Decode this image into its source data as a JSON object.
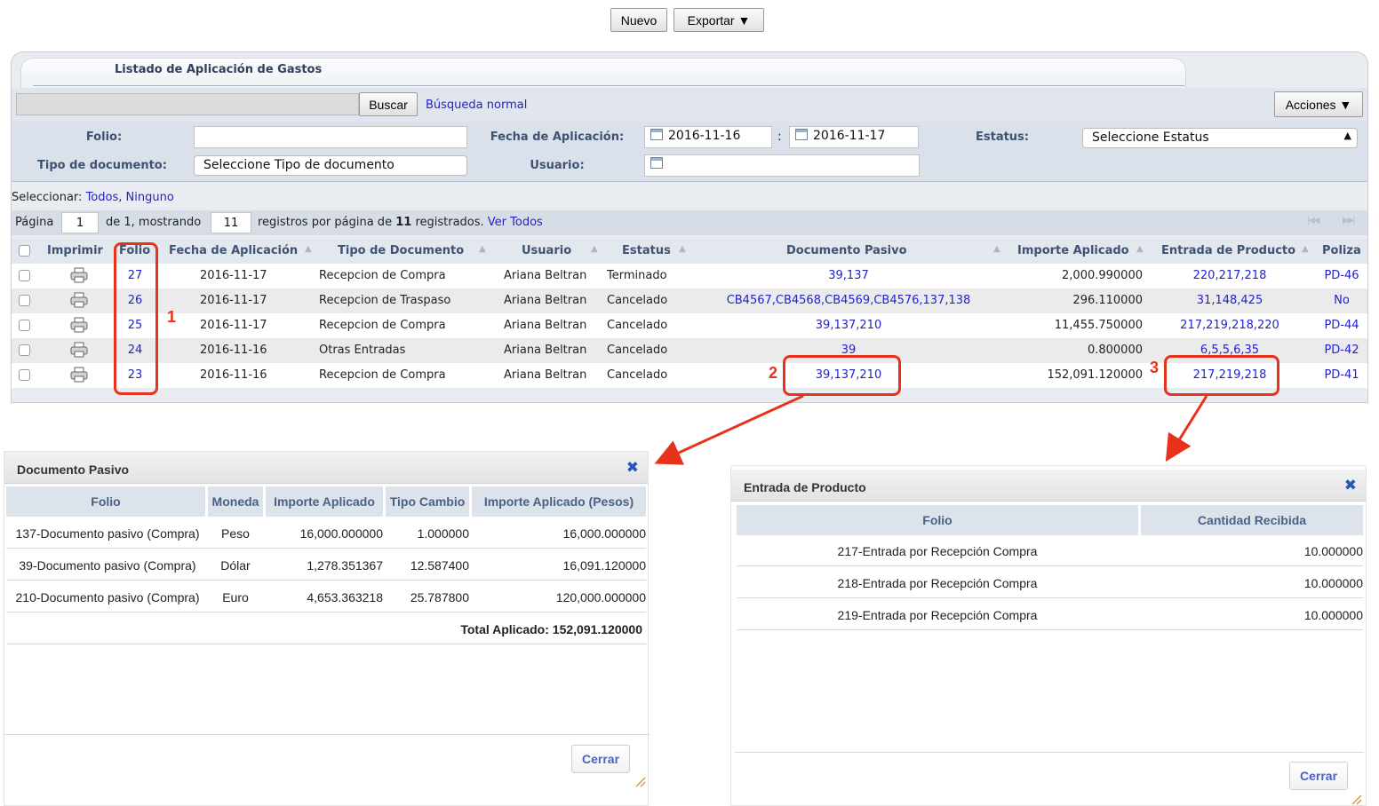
{
  "top_buttons": {
    "nuevo": "Nuevo",
    "exportar": "Exportar ▼"
  },
  "panel": {
    "title": "Listado de Aplicación de Gastos"
  },
  "search": {
    "button": "Buscar",
    "mode_link": "Búsqueda normal",
    "acciones": "Acciones ▼"
  },
  "filters": {
    "folio_label": "Folio:",
    "fecha_label": "Fecha de Aplicación:",
    "fecha_desde": "2016-11-16",
    "sep": ":",
    "fecha_hasta": "2016-11-17",
    "estatus_label": "Estatus:",
    "estatus_value": "Seleccione Estatus",
    "tipo_label": "Tipo de documento:",
    "tipo_value": "Seleccione Tipo de documento",
    "usuario_label": "Usuario:"
  },
  "selection": {
    "label": "Seleccionar:",
    "all": "Todos",
    "comma": ",",
    "none": "Ninguno"
  },
  "pager": {
    "pagina_label": "Página",
    "page": "1",
    "of_text": "de 1, mostrando",
    "per_page": "11",
    "registros_text": "registros por página de",
    "total": "11",
    "registrados": "registrados.",
    "ver_todos": "Ver Todos",
    "nav_first": "|◀◀",
    "nav_last": "▶▶|"
  },
  "columns": {
    "imprimir": "Imprimir",
    "folio": "Folio",
    "fecha": "Fecha de Aplicación",
    "tipo": "Tipo de Documento",
    "usuario": "Usuario",
    "estatus": "Estatus",
    "doc_pasivo": "Documento Pasivo",
    "importe": "Importe Aplicado",
    "entrada": "Entrada de Producto",
    "poliza": "Poliza"
  },
  "rows": [
    {
      "folio": "27",
      "fecha": "2016-11-17",
      "tipo": "Recepcion de Compra",
      "usuario": "Ariana Beltran",
      "estatus": "Terminado",
      "doc_pasivo": "39,137",
      "importe": "2,000.990000",
      "entrada": "220,217,218",
      "poliza": "PD-46"
    },
    {
      "folio": "26",
      "fecha": "2016-11-17",
      "tipo": "Recepcion de Traspaso",
      "usuario": "Ariana Beltran",
      "estatus": "Cancelado",
      "doc_pasivo": "CB4567,CB4568,CB4569,CB4576,137,138",
      "importe": "296.110000",
      "entrada": "31,148,425",
      "poliza": "No"
    },
    {
      "folio": "25",
      "fecha": "2016-11-17",
      "tipo": "Recepcion de Compra",
      "usuario": "Ariana Beltran",
      "estatus": "Cancelado",
      "doc_pasivo": "39,137,210",
      "importe": "11,455.750000",
      "entrada": "217,219,218,220",
      "poliza": "PD-44"
    },
    {
      "folio": "24",
      "fecha": "2016-11-16",
      "tipo": "Otras Entradas",
      "usuario": "Ariana Beltran",
      "estatus": "Cancelado",
      "doc_pasivo": "39",
      "importe": "0.800000",
      "entrada": "6,5,5,6,35",
      "poliza": "PD-42"
    },
    {
      "folio": "23",
      "fecha": "2016-11-16",
      "tipo": "Recepcion de Compra",
      "usuario": "Ariana Beltran",
      "estatus": "Cancelado",
      "doc_pasivo": "39,137,210",
      "importe": "152,091.120000",
      "entrada": "217,219,218",
      "poliza": "PD-41"
    }
  ],
  "annotations": {
    "one": "1",
    "two": "2",
    "three": "3",
    "color": "#e8321c"
  },
  "dialog_pasivo": {
    "title": "Documento Pasivo",
    "columns": [
      "Folio",
      "Moneda",
      "Importe Aplicado",
      "Tipo Cambio",
      "Importe Aplicado (Pesos)"
    ],
    "rows": [
      [
        "137-Documento pasivo (Compra)",
        "Peso",
        "16,000.000000",
        "1.000000",
        "16,000.000000"
      ],
      [
        "39-Documento pasivo (Compra)",
        "Dólar",
        "1,278.351367",
        "12.587400",
        "16,091.120000"
      ],
      [
        "210-Documento pasivo (Compra)",
        "Euro",
        "4,653.363218",
        "25.787800",
        "120,000.000000"
      ]
    ],
    "total": "Total Aplicado: 152,091.120000",
    "close_button": "Cerrar"
  },
  "dialog_entrada": {
    "title": "Entrada de Producto",
    "columns": [
      "Folio",
      "Cantidad Recibida"
    ],
    "rows": [
      [
        "217-Entrada por Recepción Compra",
        "10.000000"
      ],
      [
        "218-Entrada por Recepción Compra",
        "10.000000"
      ],
      [
        "219-Entrada por Recepción Compra",
        "10.000000"
      ]
    ],
    "close_button": "Cerrar"
  },
  "colors": {
    "link": "#2222cc",
    "header_text": "#3e5373",
    "close_icon": "#2856b8"
  }
}
